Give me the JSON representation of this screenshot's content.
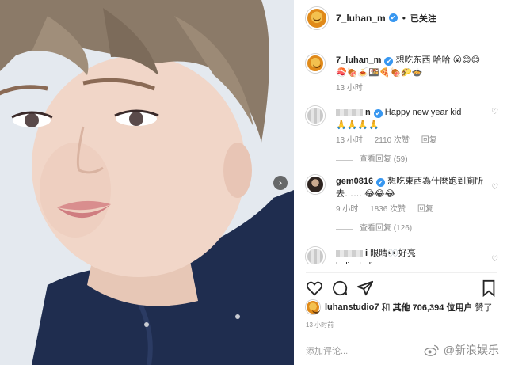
{
  "post": {
    "username": "7_luhan_m",
    "verified_mark": "✔",
    "separator": "•",
    "follow_status": "已关注",
    "caption_user": "7_luhan_m",
    "caption_text": "想吃东西 哈哈",
    "caption_emojis_line1": "😮😊😊",
    "caption_emojis_line2": "🍣🍖🍝🍱🍕🍖🌮🍲",
    "caption_time": "13 小时",
    "next_arrow": "›"
  },
  "comments": [
    {
      "avatar_icon": "blurred-avatar",
      "username_suffix": "n",
      "text": "Happy new year kid",
      "emojis": "🙏🙏🙏🙏",
      "time": "13 小时",
      "likes": "2110 次赞",
      "reply": "回复",
      "view_replies": "查看回复 (59)"
    },
    {
      "avatar_icon": "user-avatar",
      "username": "gem0816",
      "text": "想吃東西為什麼跑到廁所去……",
      "emojis": "😂😂😂",
      "time": "9 小时",
      "likes": "1836 次赞",
      "reply": "回复",
      "view_replies": "查看回复 (126)"
    },
    {
      "avatar_icon": "blurred-avatar",
      "username_suffix": "i",
      "text": "眼睛👀好亮",
      "text_line2": "bulingbuling"
    }
  ],
  "likes_line": {
    "user": "luhanstudio7",
    "and": "和",
    "others": "其他 706,394 位用户",
    "suffix": "赞了"
  },
  "post_date": "13 小时前",
  "add_comment_placeholder": "添加评论...",
  "watermark": "@新浪娱乐",
  "colors": {
    "verified_blue": "#3897f0",
    "meta_gray": "#8e8e8e",
    "hoodie_navy": "#1f2d4f"
  }
}
